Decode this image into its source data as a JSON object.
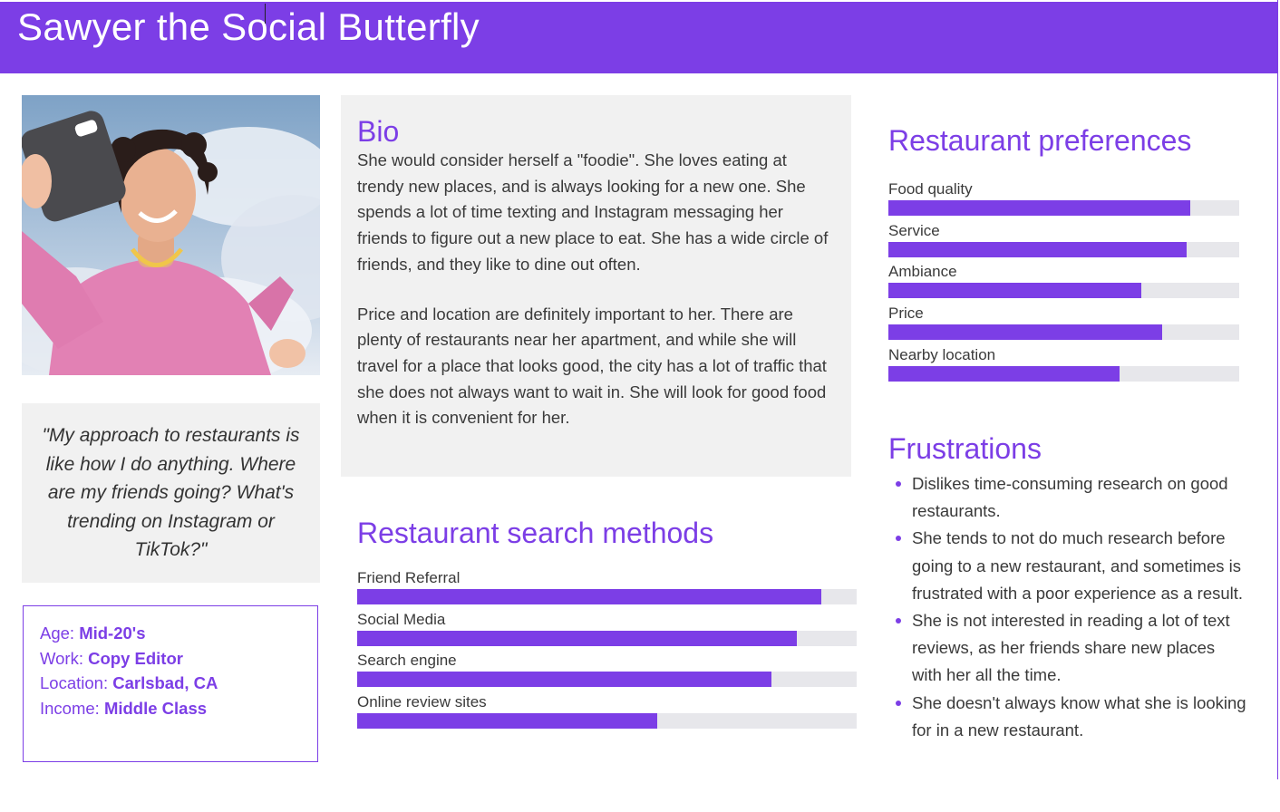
{
  "header": {
    "title": "Sawyer the Social Butterfly"
  },
  "quote": "\"My approach to restaurants is like how I do anything. Where are my friends going? What's trending on Instagram or TikTok?\"",
  "demographics": [
    {
      "label": "Age:",
      "value": "Mid-20's"
    },
    {
      "label": "Work:",
      "value": "Copy Editor"
    },
    {
      "label": "Location:",
      "value": "Carlsbad, CA"
    },
    {
      "label": "Income:",
      "value": "Middle Class"
    }
  ],
  "bio": {
    "title": "Bio",
    "paragraphs": [
      "She would consider herself a \"foodie\". She loves eating at trendy new places, and is always looking for a new one. She spends a lot of time texting and Instagram messaging her friends to figure out a new place to eat. She has a wide circle of friends, and they like to dine out often.",
      "Price and location are definitely important to her. There are plenty of restaurants near her apartment, and while she will travel for a place that looks good, the city has a lot of traffic that she does not always want to wait in. She will look for good food when it is convenient for her."
    ]
  },
  "search_methods": {
    "title": "Restaurant search methods",
    "items": [
      {
        "label": "Friend Referral",
        "value": 0.93
      },
      {
        "label": "Social Media",
        "value": 0.88
      },
      {
        "label": "Search engine",
        "value": 0.83
      },
      {
        "label": "Online review sites",
        "value": 0.6
      }
    ]
  },
  "preferences": {
    "title": "Restaurant preferences",
    "items": [
      {
        "label": "Food quality",
        "value": 0.86
      },
      {
        "label": "Service",
        "value": 0.85
      },
      {
        "label": "Ambiance",
        "value": 0.72
      },
      {
        "label": "Price",
        "value": 0.78
      },
      {
        "label": "Nearby location",
        "value": 0.66
      }
    ]
  },
  "frustrations": {
    "title": "Frustrations",
    "items": [
      "Dislikes time-consuming research on good restaurants.",
      "She tends to not do much research before going to a new restaurant, and sometimes is frustrated with a poor experience as a result.",
      "She is not interested in reading a lot of text reviews, as her friends share new places with her all the time.",
      "She doesn't always know what she is looking for in a new restaurant."
    ]
  },
  "colors": {
    "accent": "#7c3ee6",
    "panel": "#f1f1f1",
    "track": "#e7e7eb"
  }
}
